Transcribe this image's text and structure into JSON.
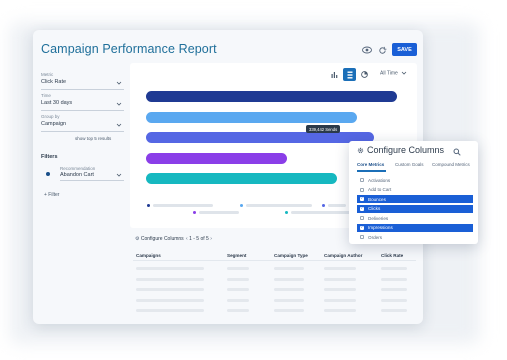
{
  "app": {
    "title": "Campaign Performance Report",
    "save_label": "SAVE"
  },
  "header_icons": [
    "eye-icon",
    "refresh-icon"
  ],
  "sidebar": {
    "fields": [
      {
        "label": "Metric",
        "value": "Click Rate"
      },
      {
        "label": "Time",
        "value": "Last 30 days"
      },
      {
        "label": "Group by",
        "value": "Campaign"
      }
    ],
    "show_top": "show top 5 results",
    "filters_label": "Filters",
    "recommendation": {
      "label": "Recommendation",
      "value": "Abandon Cart"
    },
    "add_filter": "+ Filter"
  },
  "chart_controls": {
    "views": [
      "bar-chart-icon",
      "list-icon",
      "pie-chart-icon"
    ],
    "active_view": "list-icon",
    "time_range": "All Time"
  },
  "chart_data": {
    "type": "bar",
    "orientation": "horizontal",
    "values": [
      100,
      84,
      91,
      56,
      76
    ],
    "colors": [
      "#1f3a93",
      "#5aa8f0",
      "#5567e4",
      "#8a3ee8",
      "#16b8c0"
    ],
    "tooltip": "339,442 Sends"
  },
  "footer": {
    "configure_columns": "Configure Columns",
    "pager": "1 - 5 of 5"
  },
  "table": {
    "headers": [
      "Campaigns",
      "Segment",
      "Campaign Type",
      "Campaign Author",
      "Click Rate"
    ],
    "row_count": 5
  },
  "popup": {
    "title": "Configure Columns",
    "tabs": [
      "Core Metrics",
      "Custom Goals",
      "Compound Metrics"
    ],
    "active_tab": "Core Metrics",
    "options": [
      {
        "label": "Activations",
        "checked": false
      },
      {
        "label": "Add to Cart",
        "checked": false
      },
      {
        "label": "Bounces",
        "checked": true
      },
      {
        "label": "Clicks",
        "checked": true
      },
      {
        "label": "Deliveries",
        "checked": false
      },
      {
        "label": "Impressions",
        "checked": true
      },
      {
        "label": "Orders",
        "checked": false
      }
    ]
  }
}
